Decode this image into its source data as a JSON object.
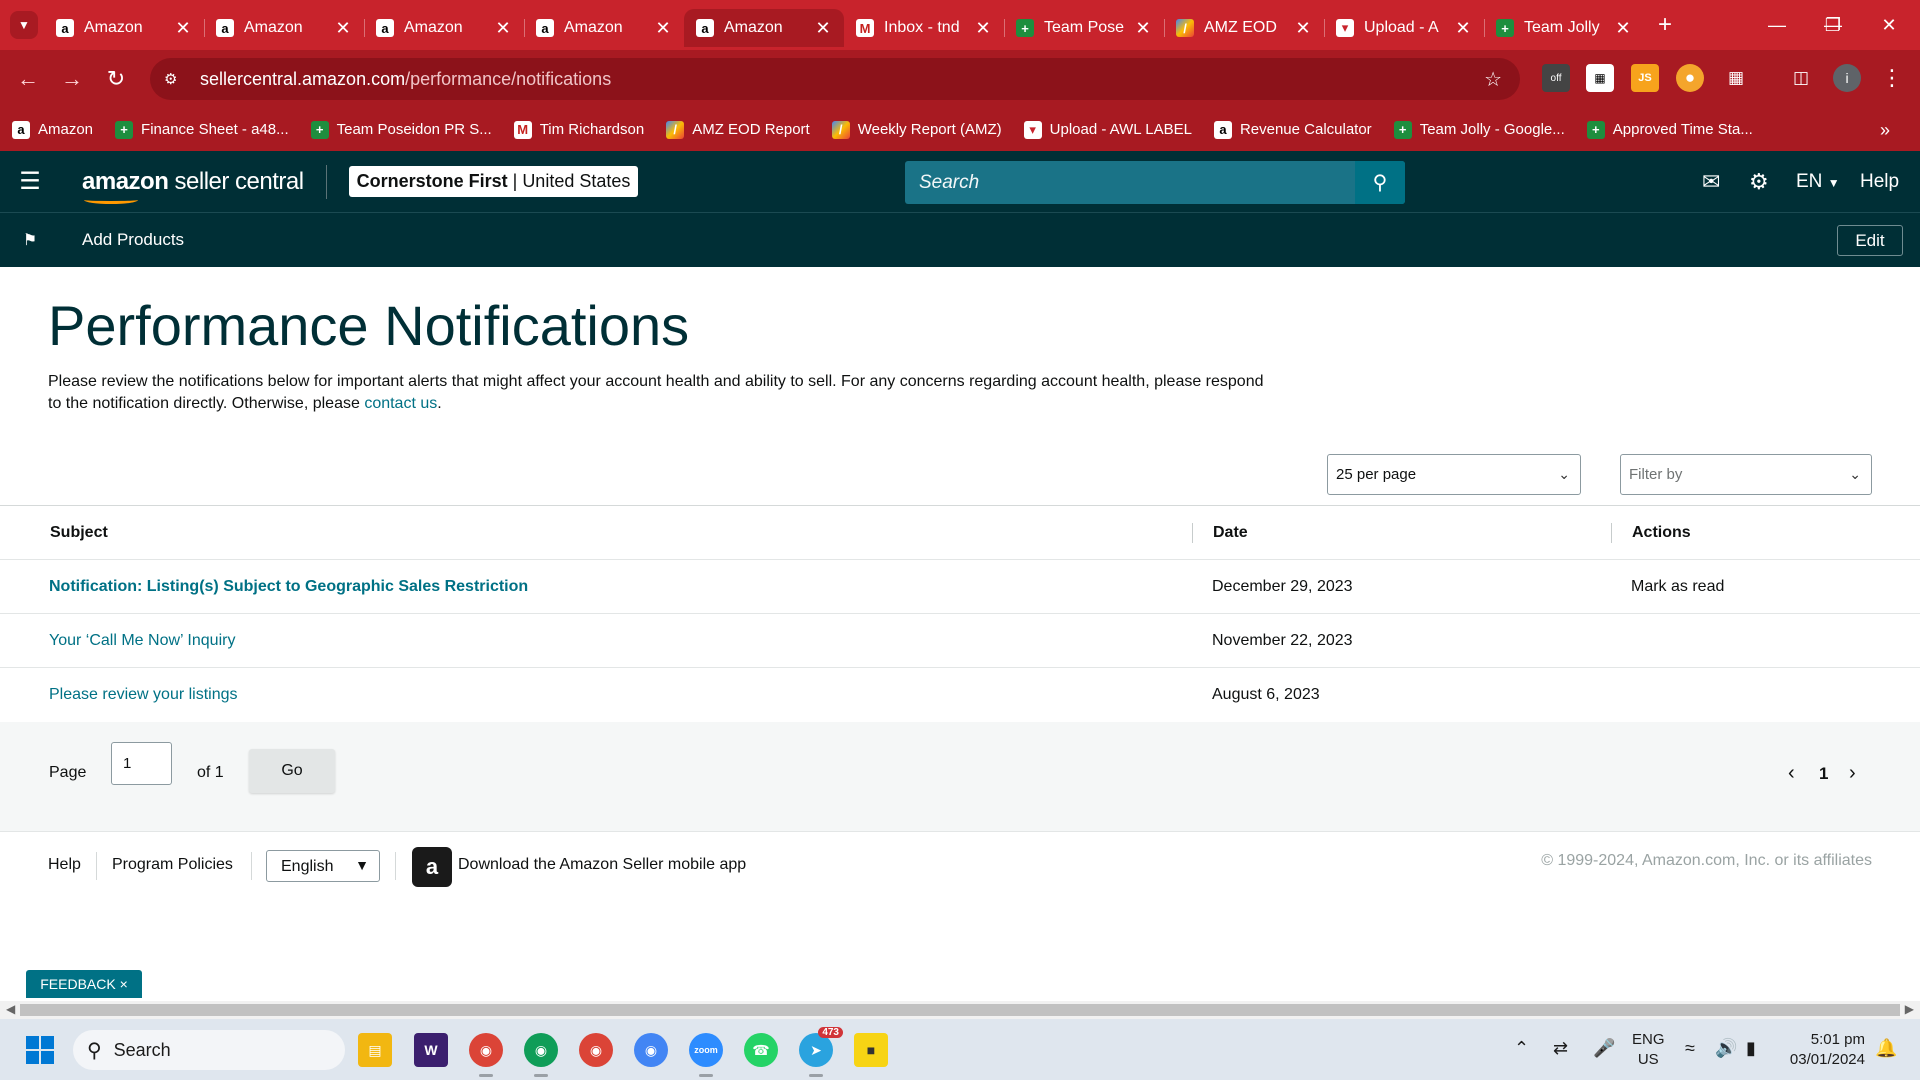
{
  "browser": {
    "tabs": [
      {
        "title": "Amazon",
        "icon": "amazon-icon",
        "active": false
      },
      {
        "title": "Amazon",
        "icon": "amazon-icon",
        "active": false
      },
      {
        "title": "Amazon",
        "icon": "amazon-icon",
        "active": false
      },
      {
        "title": "Amazon",
        "icon": "amazon-icon",
        "active": false
      },
      {
        "title": "Amazon",
        "icon": "amazon-icon",
        "active": true
      },
      {
        "title": "Inbox - tnd",
        "icon": "gmail-icon",
        "active": false
      },
      {
        "title": "Team Pose",
        "icon": "sheets-icon",
        "active": false
      },
      {
        "title": "AMZ EOD",
        "icon": "apps-script-icon",
        "active": false
      },
      {
        "title": "Upload - A",
        "icon": "upload-icon",
        "active": false
      },
      {
        "title": "Team Jolly",
        "icon": "sheets-icon",
        "active": false
      }
    ],
    "url_host": "sellercentral.amazon.com",
    "url_path": "/performance/notifications",
    "bookmarks": [
      {
        "label": "Amazon",
        "icon": "amazon-icon"
      },
      {
        "label": "Finance Sheet - a48...",
        "icon": "sheets-icon"
      },
      {
        "label": "Team Poseidon PR S...",
        "icon": "sheets-icon"
      },
      {
        "label": "Tim Richardson",
        "icon": "gmail-icon"
      },
      {
        "label": "AMZ EOD Report",
        "icon": "apps-script-icon"
      },
      {
        "label": "Weekly Report (AMZ)",
        "icon": "apps-script-icon"
      },
      {
        "label": "Upload - AWL LABEL",
        "icon": "upload-icon"
      },
      {
        "label": "Revenue Calculator",
        "icon": "amazon-icon"
      },
      {
        "label": "Team Jolly - Google...",
        "icon": "sheets-icon"
      },
      {
        "label": "Approved Time Sta...",
        "icon": "sheets-icon"
      }
    ]
  },
  "header": {
    "logo_bold": "amazon",
    "logo_rest": " seller central",
    "store_name": "Cornerstone First",
    "store_sep": " | ",
    "store_region": "United States",
    "search_placeholder": "Search",
    "language": "EN",
    "help": "Help"
  },
  "subnav": {
    "link": "Add Products",
    "edit": "Edit"
  },
  "main": {
    "title": "Performance Notifications",
    "intro": "Please review the notifications below for important alerts that might affect your account health and ability to sell. For any concerns regarding account health, please respond to the notification directly. Otherwise, please ",
    "intro_link": "contact us",
    "intro_end": ".",
    "per_page": "25 per page",
    "filter_placeholder": "Filter by",
    "table": {
      "headers": {
        "subject": "Subject",
        "date": "Date",
        "actions": "Actions"
      },
      "rows": [
        {
          "subject": "Notification: Listing(s) Subject to Geographic Sales Restriction",
          "date": "December 29, 2023",
          "action": "Mark as read",
          "unread": true
        },
        {
          "subject": "Your ‘Call Me Now’ Inquiry",
          "date": "November 22, 2023",
          "action": "",
          "unread": false
        },
        {
          "subject": "Please review your listings",
          "date": "August 6, 2023",
          "action": "",
          "unread": false
        }
      ]
    },
    "pagination": {
      "page_label": "Page",
      "page_value": "1",
      "of_label": "of 1",
      "go": "Go",
      "current": "1"
    }
  },
  "footer": {
    "help": "Help",
    "policies": "Program Policies",
    "language": "English",
    "app_text": "Download the Amazon Seller mobile app",
    "copyright": "© 1999-2024, Amazon.com, Inc. or its affiliates"
  },
  "feedback": "FEEDBACK ×",
  "taskbar": {
    "search": "Search",
    "telegram_badge": "473",
    "lang_line1": "ENG",
    "lang_line2": "US",
    "time": "5:01 pm",
    "date": "03/01/2024"
  },
  "colors": {
    "browser_red": "#c8232c",
    "seller_header": "#002f36",
    "link_teal": "#007185"
  }
}
